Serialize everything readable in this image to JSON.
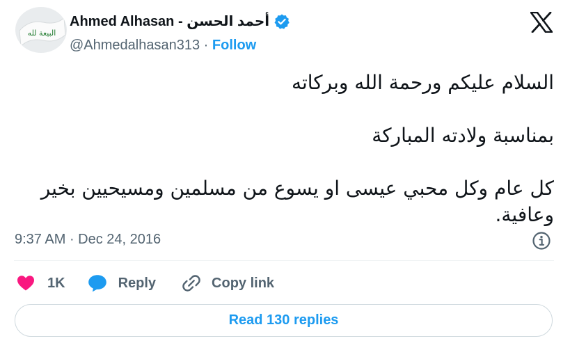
{
  "author": {
    "display_name": "Ahmed Alhasan - أحمد الحسن",
    "handle": "@Ahmedalhasan313",
    "separator": "·",
    "follow_label": "Follow",
    "avatar_text": "البيعة لله"
  },
  "tweet": {
    "text": "السلام عليكم ورحمة الله وبركاته\n\nبمناسبة ولادته المباركة\n\nكل عام وكل محبي عيسى او يسوع من مسلمين ومسيحيين بخير وعافية.",
    "time": "9:37 AM",
    "separator": "·",
    "date": "Dec 24, 2016"
  },
  "actions": {
    "like_count": "1K",
    "reply_label": "Reply",
    "copy_label": "Copy link"
  },
  "read_replies_label": "Read 130 replies",
  "colors": {
    "accent": "#1d9bf0",
    "like": "#f91880",
    "muted": "#536471",
    "text": "#0f1419",
    "avatar_flag_green": "#1f7a2e"
  },
  "icons": {
    "brand": "x-logo-icon",
    "verified": "verified-badge-icon",
    "info": "info-icon",
    "like": "heart-icon",
    "reply": "speech-bubble-icon",
    "copy": "link-icon"
  }
}
